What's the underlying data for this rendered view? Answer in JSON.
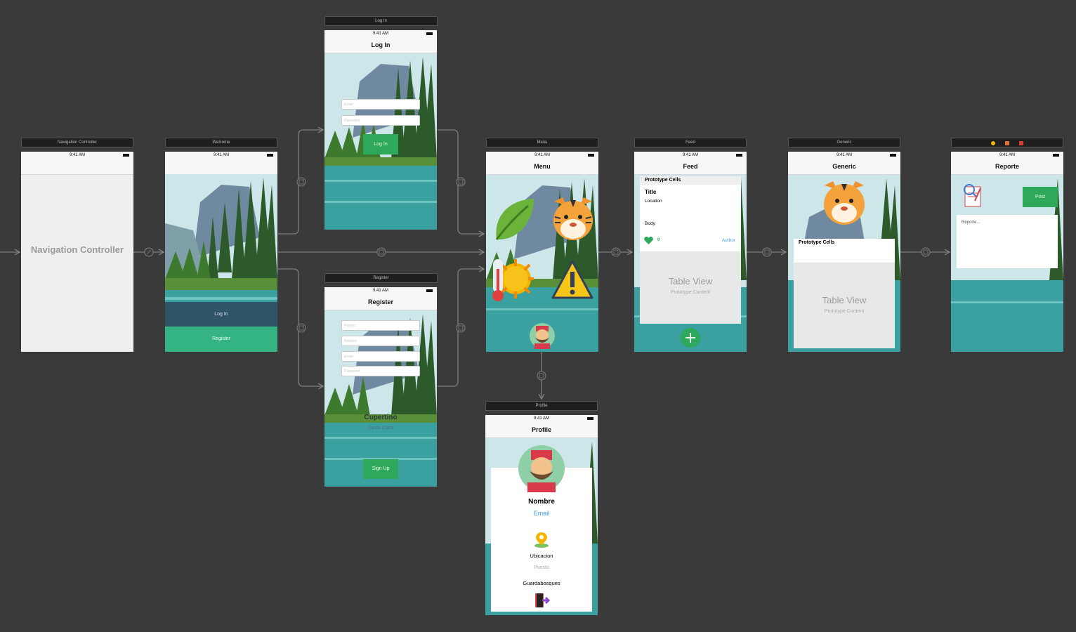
{
  "status_time": "9:41 AM",
  "nav_controller": {
    "scene_title": "Navigation Controller",
    "placeholder": "Navigation Controller"
  },
  "welcome": {
    "scene_title": "Welcome",
    "login_button": "Log In",
    "register_button": "Register"
  },
  "login": {
    "scene_title": "Log In",
    "nav_title": "Log In",
    "email_placeholder": "Email",
    "password_placeholder": "Password",
    "login_button": "Log In"
  },
  "register": {
    "scene_title": "Register",
    "nav_title": "Register",
    "puesto_placeholder": "Puesto",
    "nombre_placeholder": "Nombre",
    "email_placeholder": "Email",
    "password_placeholder": "Password",
    "picker_main": "Cupertino",
    "picker_sub": "Santa Clara",
    "signup_button": "Sign Up"
  },
  "menu": {
    "scene_title": "Menu",
    "nav_title": "Menu",
    "icons": [
      "leaf-icon",
      "tiger-icon",
      "temperature-sun-icon",
      "warning-icon",
      "ranger-avatar"
    ]
  },
  "feed": {
    "scene_title": "Feed",
    "nav_title": "Feed",
    "prototype_cells": "Prototype Cells",
    "cell_title": "Title",
    "cell_location": "Location",
    "cell_body": "Body",
    "like_count": "0",
    "author": "Author",
    "table_view": "Table View",
    "prototype_content": "Prototype Content"
  },
  "generic": {
    "scene_title": "Generic",
    "nav_title": "Generic",
    "prototype_cells": "Prototype Cells",
    "table_view": "Table View",
    "prototype_content": "Prototype Content"
  },
  "reporte": {
    "nav_title": "Reporte",
    "post_button": "Post",
    "text_placeholder": "Reporte..."
  },
  "profile": {
    "scene_title": "Profile",
    "nav_title": "Profile",
    "name": "Nombre",
    "email": "Email",
    "location": "Ubicacion",
    "puesto": "Puesto",
    "role": "Guardabosques"
  },
  "colors": {
    "canvas": "#3a3a3a",
    "green_button": "#2ea85a",
    "welcome_login_bar": "#2f5468",
    "welcome_register_bar": "#34b483",
    "link_blue": "#3b9be0"
  }
}
